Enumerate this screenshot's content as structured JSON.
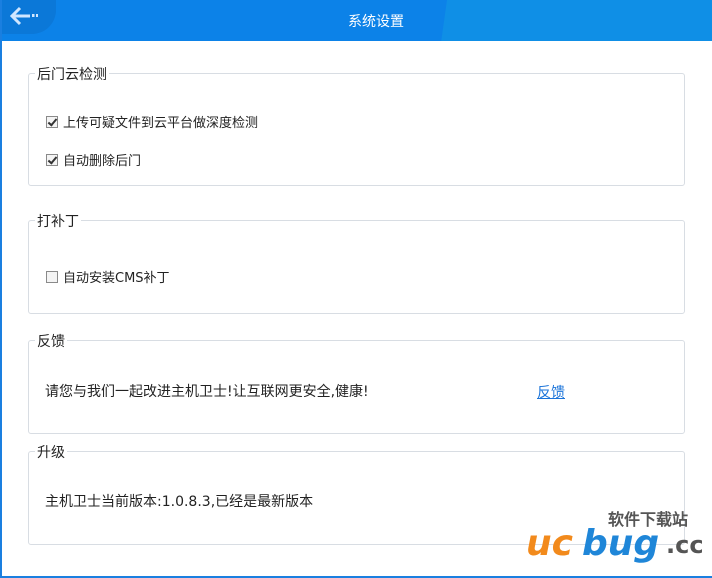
{
  "header": {
    "title": "系统设置",
    "back_icon": "arrow-left-icon"
  },
  "sections": [
    {
      "title": "后门云检测",
      "options": [
        {
          "label": "上传可疑文件到云平台做深度检测",
          "checked": true
        },
        {
          "label": "自动删除后门",
          "checked": true
        }
      ]
    },
    {
      "title": "打补丁",
      "options": [
        {
          "label": "自动安装CMS补丁",
          "checked": false
        }
      ]
    },
    {
      "title": "反馈",
      "text": "请您与我们一起改进主机卫士!让互联网更安全,健康!",
      "link": "反馈"
    },
    {
      "title": "升级",
      "text": "主机卫士当前版本:1.0.8.3,已经是最新版本"
    }
  ],
  "watermark": {
    "brand": "ucbug.cc",
    "tagline": "软件下载站"
  },
  "colors": {
    "header": "#0c82e8",
    "link": "#1a73d9"
  }
}
